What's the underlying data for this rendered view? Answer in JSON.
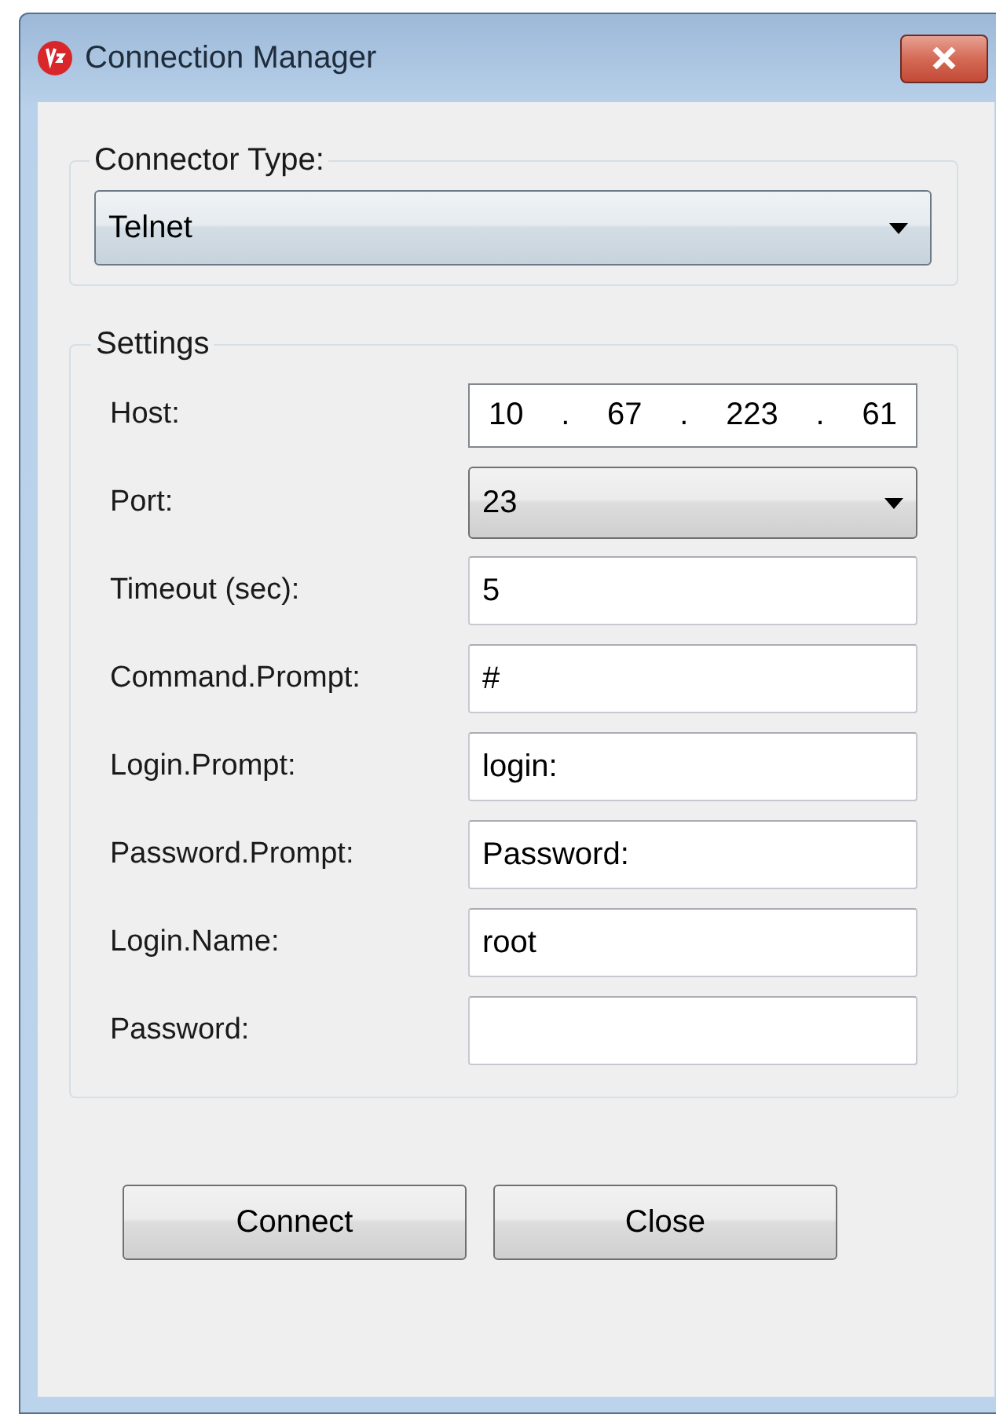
{
  "window": {
    "title": "Connection Manager"
  },
  "connector": {
    "legend": "Connector Type:",
    "value": "Telnet"
  },
  "settings": {
    "legend": "Settings",
    "fields": [
      {
        "label": "Host:",
        "kind": "ip",
        "segments": [
          "10",
          "67",
          "223",
          "61"
        ],
        "separator": "."
      },
      {
        "label": "Port:",
        "kind": "combo",
        "value": "23"
      },
      {
        "label": "Timeout (sec):",
        "kind": "text",
        "value": "5"
      },
      {
        "label": "Command.Prompt:",
        "kind": "text",
        "value": "#"
      },
      {
        "label": "Login.Prompt:",
        "kind": "text",
        "value": "login:"
      },
      {
        "label": "Password.Prompt:",
        "kind": "text",
        "value": "Password:"
      },
      {
        "label": "Login.Name:",
        "kind": "text",
        "value": "root"
      },
      {
        "label": "Password:",
        "kind": "text"
      }
    ]
  },
  "buttons": [
    "Connect",
    "Close"
  ]
}
